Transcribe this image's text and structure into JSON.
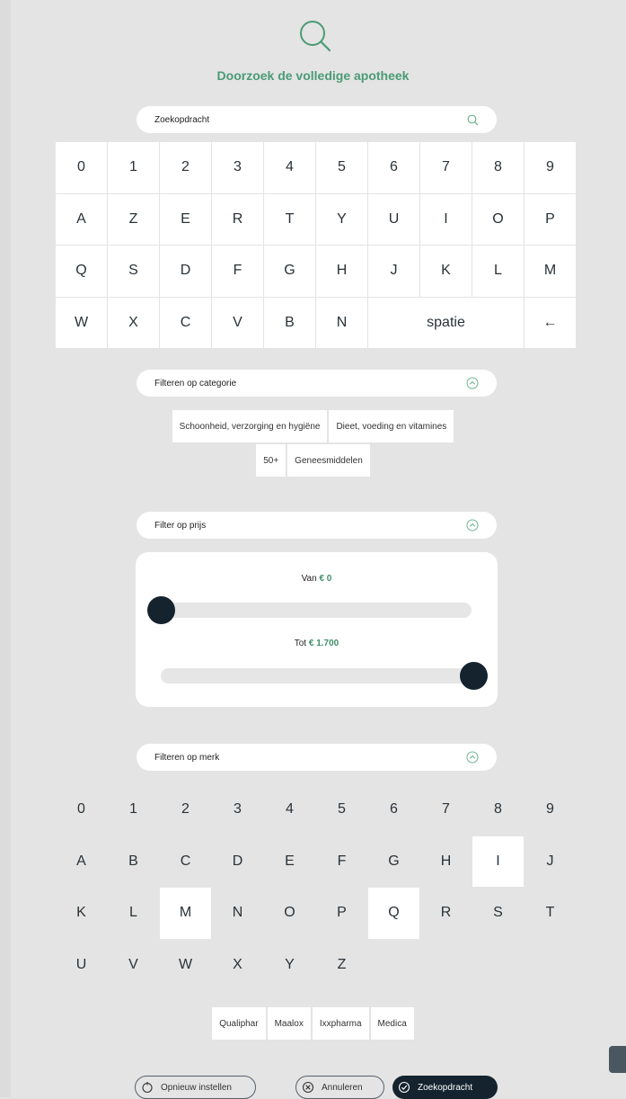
{
  "header": {
    "title": "Doorzoek de volledige apotheek",
    "icon": "search-icon"
  },
  "search": {
    "placeholder": "Zoekopdracht"
  },
  "keyboard": {
    "keys": [
      "0",
      "1",
      "2",
      "3",
      "4",
      "5",
      "6",
      "7",
      "8",
      "9",
      "A",
      "Z",
      "E",
      "R",
      "T",
      "Y",
      "U",
      "I",
      "O",
      "P",
      "Q",
      "S",
      "D",
      "F",
      "G",
      "H",
      "J",
      "K",
      "L",
      "M",
      "W",
      "X",
      "C",
      "V",
      "B",
      "N"
    ],
    "space_label": "spatie",
    "backspace_label": "←"
  },
  "category_filter": {
    "label": "Filteren op categorie",
    "chips_row1": [
      "Schoonheid, verzorging en hygiëne",
      "Dieet, voeding en vitamines"
    ],
    "chips_row2": [
      "50+",
      "Geneesmiddelen"
    ]
  },
  "price_filter": {
    "label": "Filter op prijs",
    "from_label": "Van",
    "from_value": "€ 0",
    "to_label": "Tot",
    "to_value": "€ 1.700",
    "from_position_fraction": 0.0,
    "to_position_fraction": 1.0
  },
  "brand_filter": {
    "label": "Filteren op merk",
    "letters": [
      "0",
      "1",
      "2",
      "3",
      "4",
      "5",
      "6",
      "7",
      "8",
      "9",
      "A",
      "B",
      "C",
      "D",
      "E",
      "F",
      "G",
      "H",
      "I",
      "J",
      "K",
      "L",
      "M",
      "N",
      "O",
      "P",
      "Q",
      "R",
      "S",
      "T",
      "U",
      "V",
      "W",
      "X",
      "Y",
      "Z"
    ],
    "selected": [
      "I",
      "M",
      "Q"
    ],
    "brands": [
      "Qualiphar",
      "Maalox",
      "Ixxpharma",
      "Medica"
    ]
  },
  "actions": {
    "reset_label": "Opnieuw instellen",
    "cancel_label": "Annuleren",
    "search_label": "Zoekopdracht"
  },
  "colors": {
    "accent": "#4a9b76",
    "dark": "#14232e",
    "background": "#e4e4e4"
  }
}
